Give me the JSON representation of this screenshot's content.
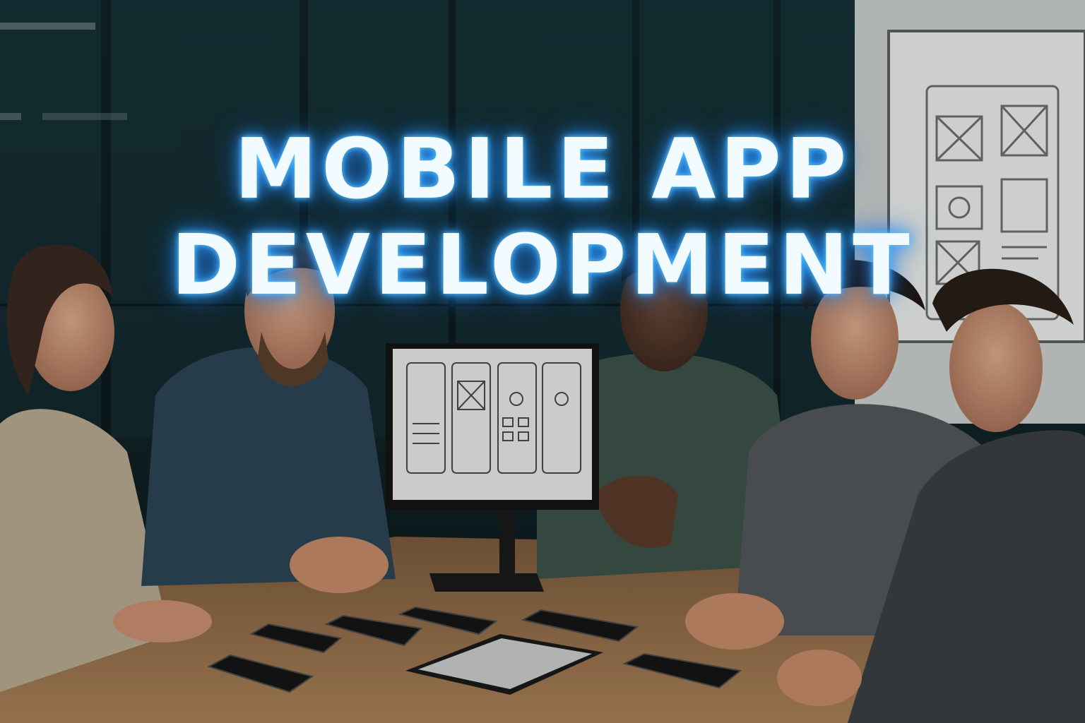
{
  "headline": {
    "line1": "MOBILE APP",
    "line2": "DEVELOPMENT"
  },
  "colors": {
    "glow": "#2f9dff",
    "text": "#f2fbff",
    "background": "#0d1a1c",
    "table": "#9c7650"
  },
  "scene": {
    "people": 5,
    "phones_on_table": 6,
    "tablets_on_table": 1,
    "monitor_wireframe_screens": 4,
    "whiteboard_wireframes": 6
  }
}
